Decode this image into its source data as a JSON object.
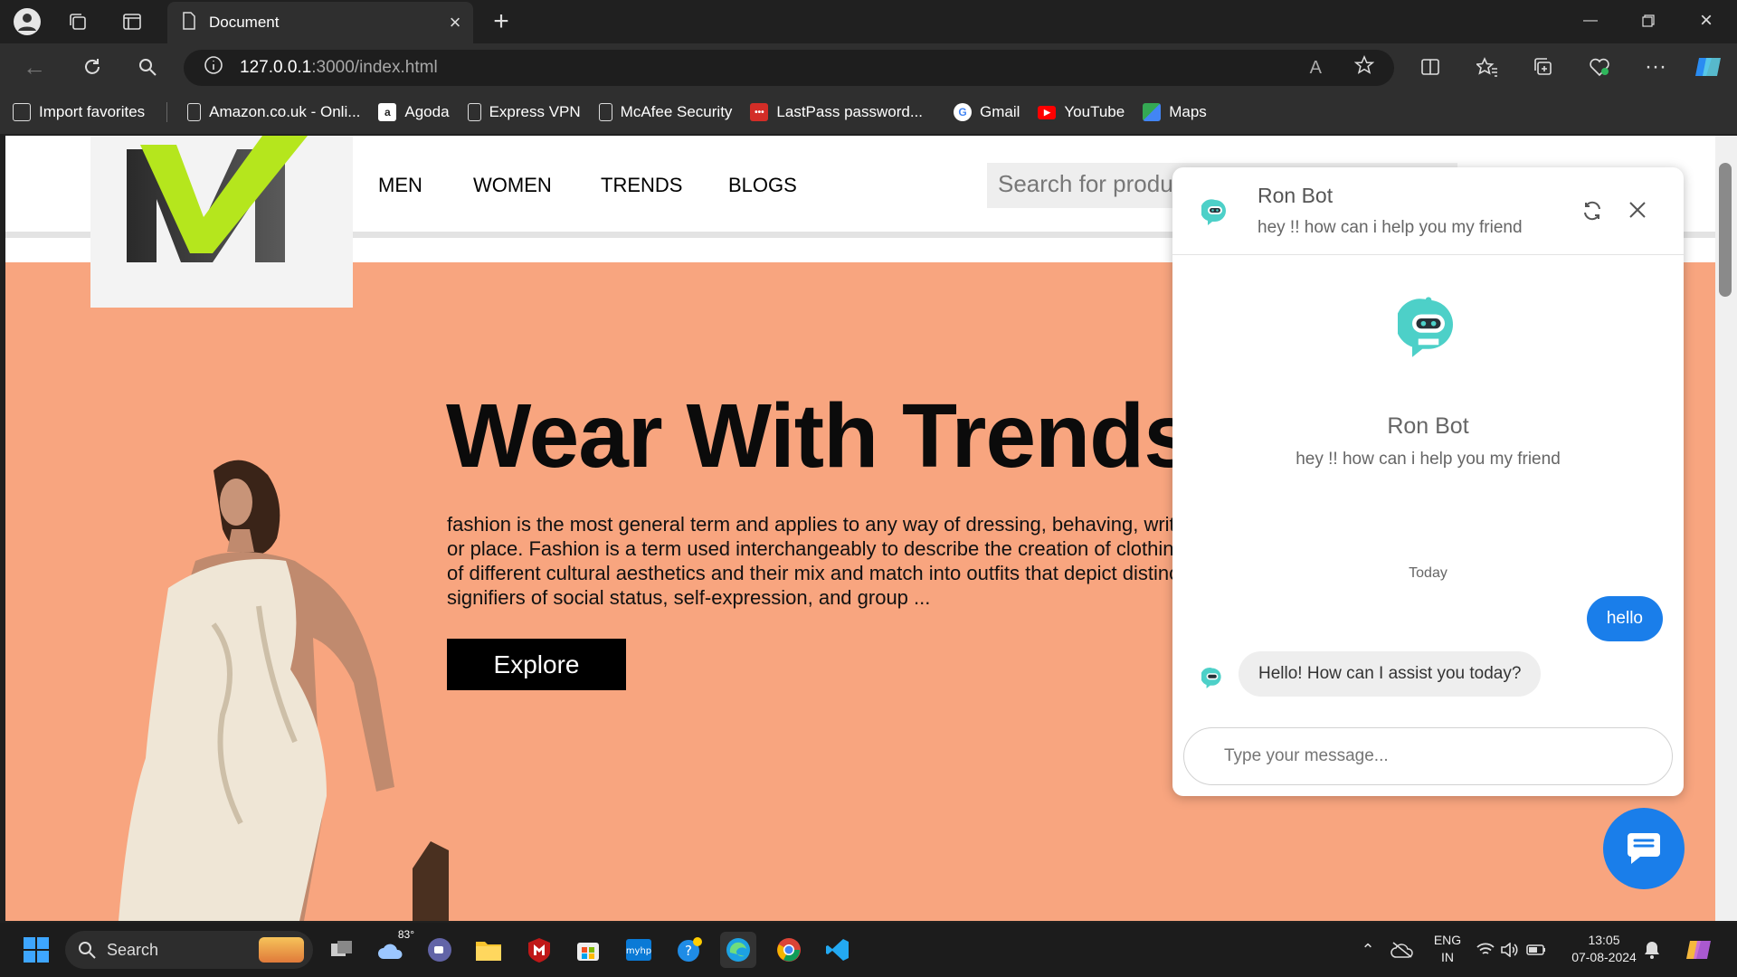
{
  "browser": {
    "tab_title": "Document",
    "url_host": "127.0.0.1",
    "url_path": ":3000/index.html",
    "read_aloud_label": "A",
    "bookmarks": [
      {
        "label": "Import favorites",
        "icon": "import-icon"
      },
      {
        "label": "Amazon.co.uk - Onli...",
        "icon": "page-icon"
      },
      {
        "label": "Agoda",
        "icon": "agoda-icon"
      },
      {
        "label": "Express VPN",
        "icon": "page-icon"
      },
      {
        "label": "McAfee Security",
        "icon": "page-icon"
      },
      {
        "label": "LastPass password...",
        "icon": "lastpass-icon"
      },
      {
        "label": "Gmail",
        "icon": "google-icon"
      },
      {
        "label": "YouTube",
        "icon": "youtube-icon"
      },
      {
        "label": "Maps",
        "icon": "maps-icon"
      }
    ]
  },
  "site": {
    "nav": [
      "MEN",
      "WOMEN",
      "TRENDS",
      "BLOGS"
    ],
    "search_placeholder": "Search for products",
    "hero_title": "Wear With Trends",
    "hero_text": "fashion is the most general term and applies to any way of dressing, behaving, writing, or performing that is favored at any one time or place. Fashion is a term used interchangeably to describe the creation of clothing, footwear, accessories, cosmetics, and jewellery of different cultural aesthetics and their mix and match into outfits that depict distinctive ways of dressing (styles and trends) as signifiers of social status, self-expression, and group ...",
    "explore_label": "Explore",
    "colors": {
      "hero_bg": "#f8a57f",
      "logo_green": "#b5e61d",
      "logo_dark": "#3a3a3a"
    }
  },
  "chat": {
    "bot_name": "Ron Bot",
    "bot_tagline": "hey !! how can i help you my friend",
    "day_label": "Today",
    "messages": [
      {
        "from": "user",
        "text": "hello"
      },
      {
        "from": "bot",
        "text": "Hello! How can I assist you today?"
      }
    ],
    "input_placeholder": "Type your message...",
    "accent": "#1a7eea"
  },
  "taskbar": {
    "search_label": "Search",
    "weather_temp": "83°",
    "language": "ENG",
    "region": "IN",
    "time": "13:05",
    "date": "07-08-2024"
  }
}
